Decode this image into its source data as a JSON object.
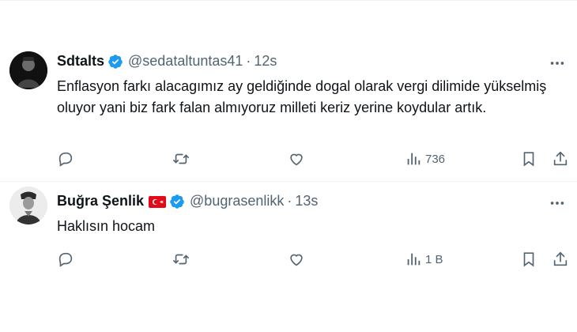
{
  "tweets": [
    {
      "display_name": "Sdtalts",
      "handle": "@sedataltuntas41",
      "separator": "·",
      "time": "12s",
      "text": "Enflasyon farkı alacagımız ay geldiğinde dogal olarak vergi dilimide yükselmiş oluyor yani biz fark falan almıyoruz milleti keriz yerine koydular artık.",
      "views": "736",
      "flag": false
    },
    {
      "display_name": "Buğra Şenlik",
      "handle": "@bugrasenlikk",
      "separator": "·",
      "time": "13s",
      "text": "Haklısın hocam",
      "views": "1 B",
      "flag": true
    }
  ],
  "icons": {
    "reply": "reply-icon",
    "retweet": "retweet-icon",
    "like": "like-icon",
    "views": "views-icon",
    "bookmark": "bookmark-icon",
    "share": "share-icon",
    "more": "more-icon",
    "verified": "verified-badge-icon",
    "flag": "turkey-flag-icon"
  },
  "colors": {
    "text": "#0f1419",
    "secondary": "#536471",
    "verified": "#1d9bf0",
    "flag_red": "#e30a17",
    "divider": "#eff3f4"
  }
}
